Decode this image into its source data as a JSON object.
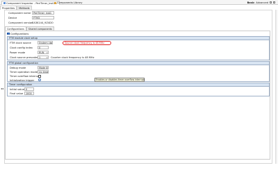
{
  "tabs": [
    {
      "label": "Component Inspector - PeriTimer_inst1"
    },
    {
      "label": "Components Library"
    }
  ],
  "view_modes": {
    "basic": "Basic",
    "advanced": "Advanced"
  },
  "subtabs": [
    "Properties",
    "Methods"
  ],
  "component": {
    "name_label": "Component name",
    "name_value": "PeriTimer_inst1",
    "device_label": "Device",
    "device_value": "FTM3",
    "version_label": "Component version",
    "version_value": "EA3K144_9Z4DO"
  },
  "inner_tabs": [
    "Configurations",
    "Shared components"
  ],
  "configurations_label": "Configurations",
  "ftm_clock": {
    "header": "FTM module clock setup",
    "clock_source_label": "FTM clock source",
    "clock_source_value": "System clock",
    "clock_source_note": "Source clock frequency is 48 MHz",
    "config_index_label": "Clock config index",
    "config_index_value": "0",
    "power_mode_label": "Power mode",
    "power_mode_value": "RUN",
    "prescaler_label": "Clock source prescaler",
    "prescaler_value": "1",
    "counter_freq_note": "Counter clock frequency is 48 MHz"
  },
  "ftm_global": {
    "header": "FTM global configuration",
    "debug_mode_label": "Debug mode",
    "debug_mode_value": "Mode 0",
    "timer_op_label": "Timer operation mode",
    "timer_op_value": "Up timer",
    "overflow_int_label": "Timer overflow interrupt",
    "init_trigger_label": "Initialization trigger",
    "tooltip": "Enables or disables timer overflow interrupt"
  },
  "timer_config": {
    "header": "Timer configuration",
    "initial_label": "Initial value",
    "initial_value": "0",
    "final_label": "Final value",
    "final_value": "1000"
  },
  "left_arrows": "◂◂",
  "colors": {
    "accent": "#2d6fcf",
    "section_header": "#d8e4f2",
    "callout": "#e02020"
  }
}
